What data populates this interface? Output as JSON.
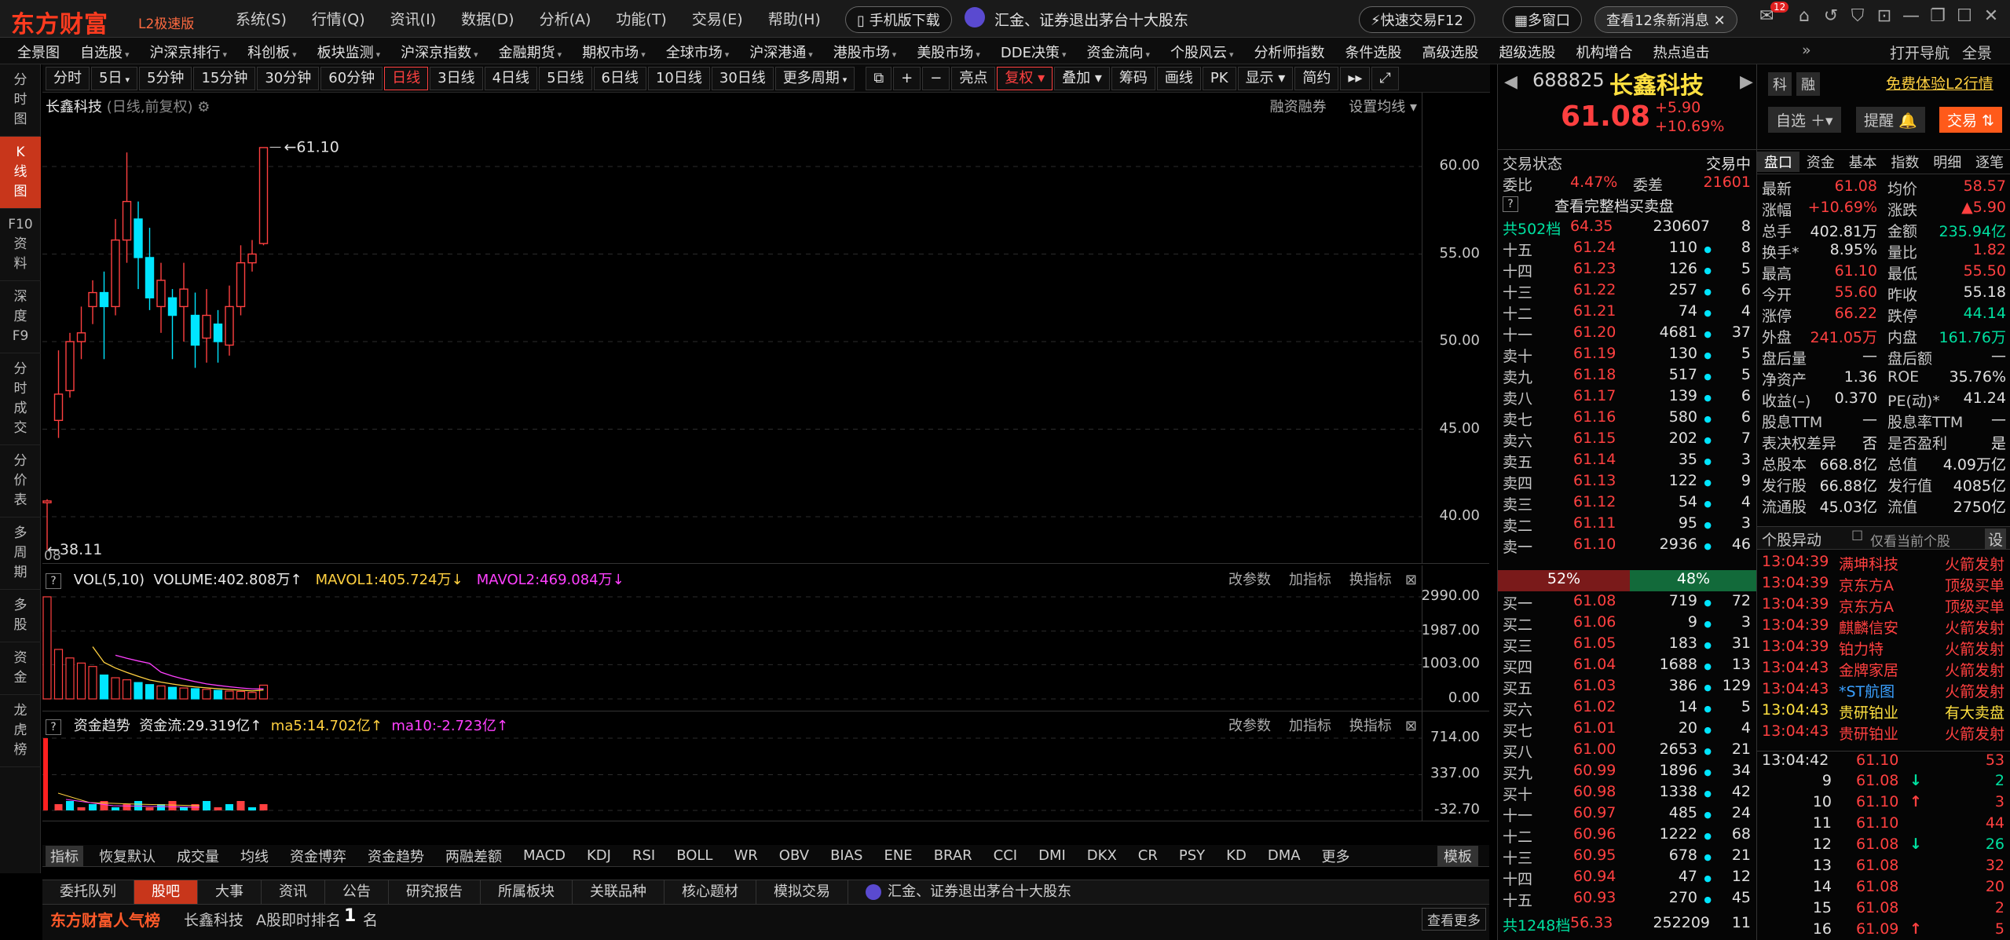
{
  "app": {
    "name": "东方财富",
    "edition": "L2极速版"
  },
  "menu": [
    "系统(S)",
    "行情(Q)",
    "资讯(I)",
    "数据(D)",
    "分析(A)",
    "功能(T)",
    "交易(E)",
    "帮助(H)"
  ],
  "titlebar": {
    "mobile_btn": "手机版下载",
    "news_ticker": "汇金、证券退出茅台十大股东",
    "quick_trade": "快速交易F12",
    "multi_window": "多窗口",
    "new_msgs": "查看12条新消息",
    "mail_badge": "12"
  },
  "nav": [
    "全景图",
    "自选股",
    "沪深京排行",
    "科创板",
    "板块监测",
    "沪深京指数",
    "金融期货",
    "期权市场",
    "全球市场",
    "沪深港通",
    "港股市场",
    "美股市场",
    "DDE决策",
    "资金流向",
    "个股风云",
    "分析师指数",
    "条件选股",
    "高级选股",
    "超级选股",
    "机构增合",
    "热点追击"
  ],
  "nav_right": [
    "打开导航",
    "全景"
  ],
  "sidebar": [
    {
      "label": "分\n时\n图",
      "active": false
    },
    {
      "label": "K\n线\n图",
      "active": true
    },
    {
      "label": "F10\n资\n料",
      "active": false
    },
    {
      "label": "深\n度\nF9",
      "active": false
    },
    {
      "label": "分\n时\n成\n交",
      "active": false
    },
    {
      "label": "分\n价\n表",
      "active": false
    },
    {
      "label": "多\n周\n期",
      "active": false
    },
    {
      "label": "多\n股",
      "active": false
    },
    {
      "label": "资\n金",
      "active": false
    },
    {
      "label": "龙\n虎\n榜",
      "active": false
    }
  ],
  "toolbar": {
    "periods": [
      "分时",
      "5日",
      "5分钟",
      "15分钟",
      "30分钟",
      "60分钟",
      "日线",
      "3日线",
      "4日线",
      "5日线",
      "6日线",
      "10日线",
      "30日线",
      "更多周期"
    ],
    "selected": "日线",
    "tools": [
      "亮点",
      "复权",
      "叠加",
      "筹码",
      "画线",
      "PK",
      "显示",
      "简约"
    ]
  },
  "chart": {
    "title": "长鑫科技",
    "subtitle": "(日线,前复权)",
    "right_links": [
      "融资融券",
      "设置均线"
    ],
    "hi_label": "61.10",
    "lo_label": "38.11",
    "y_ticks": [
      "60.00",
      "55.00",
      "50.00",
      "45.00",
      "40.00"
    ],
    "date_label": "08"
  },
  "chart_data": {
    "type": "candlestick",
    "title": "长鑫科技 (日线,前复权)",
    "ylim": [
      38,
      63
    ],
    "candles": [
      {
        "o": 40.8,
        "c": 40.9,
        "h": 41.0,
        "l": 38.11
      },
      {
        "o": 45.5,
        "c": 47.0,
        "h": 49.5,
        "l": 44.5
      },
      {
        "o": 47.2,
        "c": 50.0,
        "h": 50.5,
        "l": 46.8
      },
      {
        "o": 50.0,
        "c": 50.5,
        "h": 52.0,
        "l": 49.0
      },
      {
        "o": 52.0,
        "c": 52.8,
        "h": 53.5,
        "l": 51.0
      },
      {
        "o": 52.8,
        "c": 52.0,
        "h": 54.0,
        "l": 49.0
      },
      {
        "o": 52.0,
        "c": 55.8,
        "h": 57.0,
        "l": 51.5
      },
      {
        "o": 55.8,
        "c": 58.0,
        "h": 60.8,
        "l": 54.5
      },
      {
        "o": 57.0,
        "c": 54.8,
        "h": 58.0,
        "l": 53.0
      },
      {
        "o": 54.8,
        "c": 52.5,
        "h": 56.5,
        "l": 51.8
      },
      {
        "o": 52.0,
        "c": 53.5,
        "h": 54.5,
        "l": 50.5
      },
      {
        "o": 52.5,
        "c": 51.5,
        "h": 53.0,
        "l": 49.0
      },
      {
        "o": 52.0,
        "c": 53.0,
        "h": 54.5,
        "l": 50.0
      },
      {
        "o": 51.5,
        "c": 49.8,
        "h": 52.8,
        "l": 48.5
      },
      {
        "o": 50.2,
        "c": 51.5,
        "h": 53.0,
        "l": 48.8
      },
      {
        "o": 51.0,
        "c": 50.0,
        "h": 51.8,
        "l": 48.8
      },
      {
        "o": 49.8,
        "c": 52.0,
        "h": 53.2,
        "l": 49.2
      },
      {
        "o": 52.0,
        "c": 54.5,
        "h": 55.5,
        "l": 51.5
      },
      {
        "o": 54.5,
        "c": 55.0,
        "h": 55.8,
        "l": 54.0
      },
      {
        "o": 55.6,
        "c": 61.08,
        "h": 61.1,
        "l": 55.5
      }
    ],
    "volume": {
      "label": "VOL(5,10)",
      "value": "VOLUME:402.808万",
      "mavol1": "MAVOL1:405.724万",
      "mavol2": "MAVOL2:469.084万",
      "y_ticks": [
        "2990.00",
        "1987.00",
        "1003.00",
        "0.00"
      ],
      "bars": [
        2990,
        1450,
        1200,
        1050,
        950,
        700,
        620,
        560,
        480,
        420,
        380,
        340,
        320,
        300,
        280,
        250,
        230,
        220,
        190,
        402.8
      ]
    },
    "fund_flow": {
      "label": "资金趋势",
      "value": "资金流:29.319亿",
      "ma5": "ma5:14.702亿",
      "ma10": "ma10:-2.723亿",
      "y_ticks": [
        "714.00",
        "337.00",
        "-32.70"
      ]
    }
  },
  "panel_links": [
    "改参数",
    "加指标",
    "换指标"
  ],
  "indicators": [
    "指标",
    "恢复默认",
    "成交量",
    "均线",
    "资金博弈",
    "资金趋势",
    "两融差额",
    "MACD",
    "KDJ",
    "RSI",
    "BOLL",
    "WR",
    "OBV",
    "BIAS",
    "ENE",
    "BRAR",
    "CCI",
    "DMI",
    "DKX",
    "CR",
    "PSY",
    "KD",
    "DMA",
    "更多",
    "模板"
  ],
  "bottom_tabs": [
    "委托队列",
    "股吧",
    "大事",
    "资讯",
    "公告",
    "研究报告",
    "所属板块",
    "关联品种",
    "核心题材",
    "模拟交易"
  ],
  "bottom_news": "汇金、证券退出茅台十大股东",
  "rank": {
    "brand": "东方财富人气榜",
    "stock": "长鑫科技",
    "label": "A股即时排名",
    "num": "1",
    "unit": "名",
    "more": "查看更多"
  },
  "stock": {
    "code": "688825",
    "name": "长鑫科技",
    "price": "61.08",
    "change": "+5.90",
    "pct": "+10.69%",
    "tags": [
      "科",
      "融"
    ],
    "promo": "免费体验L2行情",
    "btn_watch": "自选",
    "btn_alert": "提醒",
    "btn_trade": "交易"
  },
  "orderbook": {
    "status_label": "交易状态",
    "status": "交易中",
    "wb_label": "委比",
    "wb": "4.47%",
    "wc_label": "委差",
    "wc": "21601",
    "full_btn": "查看完整档买卖盘",
    "sell_total": {
      "label": "共502档",
      "price": "64.35",
      "vol": "230607",
      "n": "8"
    },
    "asks": [
      [
        "十五",
        "61.24",
        "110",
        "8"
      ],
      [
        "十四",
        "61.23",
        "126",
        "5"
      ],
      [
        "十三",
        "61.22",
        "257",
        "6"
      ],
      [
        "十二",
        "61.21",
        "74",
        "4"
      ],
      [
        "十一",
        "61.20",
        "4681",
        "37"
      ],
      [
        "卖十",
        "61.19",
        "130",
        "5"
      ],
      [
        "卖九",
        "61.18",
        "517",
        "5"
      ],
      [
        "卖八",
        "61.17",
        "139",
        "6"
      ],
      [
        "卖七",
        "61.16",
        "580",
        "6"
      ],
      [
        "卖六",
        "61.15",
        "202",
        "7"
      ],
      [
        "卖五",
        "61.14",
        "35",
        "3"
      ],
      [
        "卖四",
        "61.13",
        "122",
        "9"
      ],
      [
        "卖三",
        "61.12",
        "54",
        "4"
      ],
      [
        "卖二",
        "61.11",
        "95",
        "3"
      ],
      [
        "卖一",
        "61.10",
        "2936",
        "46"
      ]
    ],
    "ratio": {
      "buy": "52%",
      "sell": "48%"
    },
    "bids": [
      [
        "买一",
        "61.08",
        "719",
        "72"
      ],
      [
        "买二",
        "61.06",
        "9",
        "3"
      ],
      [
        "买三",
        "61.05",
        "183",
        "31"
      ],
      [
        "买四",
        "61.04",
        "1688",
        "13"
      ],
      [
        "买五",
        "61.03",
        "386",
        "129"
      ],
      [
        "买六",
        "61.02",
        "14",
        "5"
      ],
      [
        "买七",
        "61.01",
        "20",
        "4"
      ],
      [
        "买八",
        "61.00",
        "2653",
        "21"
      ],
      [
        "买九",
        "60.99",
        "1896",
        "34"
      ],
      [
        "买十",
        "60.98",
        "1338",
        "42"
      ],
      [
        "十一",
        "60.97",
        "485",
        "24"
      ],
      [
        "十二",
        "60.96",
        "1222",
        "68"
      ],
      [
        "十三",
        "60.95",
        "678",
        "21"
      ],
      [
        "十四",
        "60.94",
        "47",
        "12"
      ],
      [
        "十五",
        "60.93",
        "270",
        "45"
      ]
    ],
    "buy_total": {
      "label": "共1248档",
      "price": "56.33",
      "vol": "252209",
      "n": "11"
    }
  },
  "info_tabs": [
    "盘口",
    "资金",
    "基本",
    "指数",
    "明细",
    "逐笔"
  ],
  "info_rows": [
    [
      "最新",
      "61.08",
      "均价",
      "58.57"
    ],
    [
      "涨幅",
      "+10.69%",
      "涨跌",
      "▲5.90"
    ],
    [
      "总手",
      "402.81万",
      "金额",
      "235.94亿"
    ],
    [
      "换手*",
      "8.95%",
      "量比",
      "1.82"
    ],
    [
      "最高",
      "61.10",
      "最低",
      "55.50"
    ],
    [
      "今开",
      "55.60",
      "昨收",
      "55.18"
    ],
    [
      "涨停",
      "66.22",
      "跌停",
      "44.14"
    ],
    [
      "外盘",
      "241.05万",
      "内盘",
      "161.76万"
    ],
    [
      "盘后量",
      "—",
      "盘后额",
      "—"
    ],
    [
      "净资产",
      "1.36",
      "ROE",
      "35.76%"
    ],
    [
      "收益(–)",
      "0.370",
      "PE(动)*",
      "41.24"
    ],
    [
      "股息TTM",
      "—",
      "股息率TTM",
      "—"
    ],
    [
      "表决权差异",
      "否",
      "是否盈利",
      "是"
    ],
    [
      "总股本",
      "668.8亿",
      "总值",
      "4.09万亿"
    ],
    [
      "发行股",
      "66.88亿",
      "发行值",
      "4085亿"
    ],
    [
      "流通股",
      "45.03亿",
      "流值",
      "2750亿"
    ]
  ],
  "movers": {
    "title": "个股异动",
    "checkbox": "仅看当前个股",
    "settings": "设",
    "rows": [
      [
        "13:04:39",
        "满坤科技",
        "火箭发射"
      ],
      [
        "13:04:39",
        "京东方A",
        "顶级买单"
      ],
      [
        "13:04:39",
        "京东方A",
        "顶级买单"
      ],
      [
        "13:04:39",
        "麒麟信安",
        "火箭发射"
      ],
      [
        "13:04:39",
        "铂力特",
        "火箭发射"
      ],
      [
        "13:04:43",
        "金牌家居",
        "火箭发射"
      ],
      [
        "13:04:43",
        "*ST航图",
        "火箭发射"
      ],
      [
        "13:04:43",
        "贵研铂业",
        "有大卖盘"
      ],
      [
        "13:04:43",
        "贵研铂业",
        "火箭发射"
      ]
    ]
  },
  "ticks": [
    [
      "13:04:42",
      "61.10",
      "",
      "53"
    ],
    [
      "9",
      "61.08",
      "↓",
      "2"
    ],
    [
      "10",
      "61.10",
      "↑",
      "3"
    ],
    [
      "11",
      "61.10",
      "",
      "44"
    ],
    [
      "12",
      "61.08",
      "↓",
      "26"
    ],
    [
      "13",
      "61.08",
      "",
      "32"
    ],
    [
      "14",
      "61.08",
      "",
      "20"
    ],
    [
      "15",
      "61.08",
      "",
      "2"
    ],
    [
      "16",
      "61.09",
      "↑",
      "5"
    ]
  ]
}
